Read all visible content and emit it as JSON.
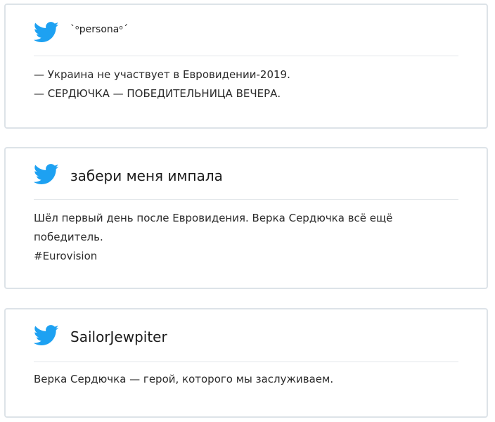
{
  "colors": {
    "bird": "#1da1f2",
    "border": "#dde3e8",
    "divider": "#e3e7ea",
    "text": "#2a2a2a"
  },
  "tweets": [
    {
      "icon": "twitter-bird-icon",
      "author": "`ᵒpersonaᵒ´",
      "text": "— Украина не участвует в Евровидении-2019.\n— СЕРДЮЧКА — ПОБЕДИТЕЛЬНИЦА ВЕЧЕРА."
    },
    {
      "icon": "twitter-bird-icon",
      "author": "забери меня импала",
      "text": "Шёл первый день после Евровидения. Верка Сердючка всё ещё\nпобедитель.\n#Eurovision"
    },
    {
      "icon": "twitter-bird-icon",
      "author": "SailorJewpiter",
      "text": "Верка Сердючка — герой, которого мы заслуживаем."
    }
  ]
}
